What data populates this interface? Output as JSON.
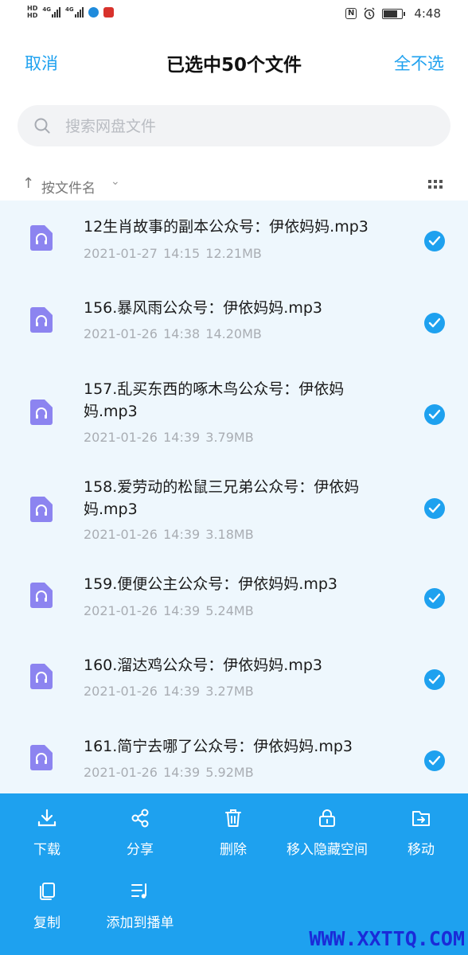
{
  "status_bar": {
    "hd1": "HD",
    "hd2": "HD",
    "net1": "4G",
    "net2": "4G",
    "time": "4:48",
    "nfc": "N",
    "battery_level": 0.68
  },
  "header": {
    "cancel_label": "取消",
    "title": "已选中50个文件",
    "deselect_all_label": "全不选"
  },
  "search": {
    "placeholder": "搜索网盘文件"
  },
  "sort": {
    "label": "按文件名"
  },
  "files": [
    {
      "name": "12生肖故事的副本公众号：伊依妈妈.mp3",
      "date": "2021-01-27",
      "time": "14:15",
      "size": "12.21MB",
      "selected": true
    },
    {
      "name": "156.暴风雨公众号：伊依妈妈.mp3",
      "date": "2021-01-26",
      "time": "14:38",
      "size": "14.20MB",
      "selected": true
    },
    {
      "name": "157.乱买东西的啄木鸟公众号：伊依妈妈.mp3",
      "date": "2021-01-26",
      "time": "14:39",
      "size": "3.79MB",
      "selected": true
    },
    {
      "name": "158.爱劳动的松鼠三兄弟公众号：伊依妈妈.mp3",
      "date": "2021-01-26",
      "time": "14:39",
      "size": "3.18MB",
      "selected": true
    },
    {
      "name": "159.便便公主公众号：伊依妈妈.mp3",
      "date": "2021-01-26",
      "time": "14:39",
      "size": "5.24MB",
      "selected": true
    },
    {
      "name": "160.溜达鸡公众号：伊依妈妈.mp3",
      "date": "2021-01-26",
      "time": "14:39",
      "size": "3.27MB",
      "selected": true
    },
    {
      "name": "161.简宁去哪了公众号：伊依妈妈.mp3",
      "date": "2021-01-26",
      "time": "14:39",
      "size": "5.92MB",
      "selected": true
    }
  ],
  "actions": {
    "download": "下载",
    "share": "分享",
    "delete": "删除",
    "hide": "移入隐藏空间",
    "move": "移动",
    "copy": "复制",
    "playlist": "添加到播单"
  },
  "watermark": "WWW.XXTTQ.COM",
  "colors": {
    "accent": "#1ea1ef",
    "list_bg": "#eef7fd",
    "file_icon": "#8c84f0"
  }
}
